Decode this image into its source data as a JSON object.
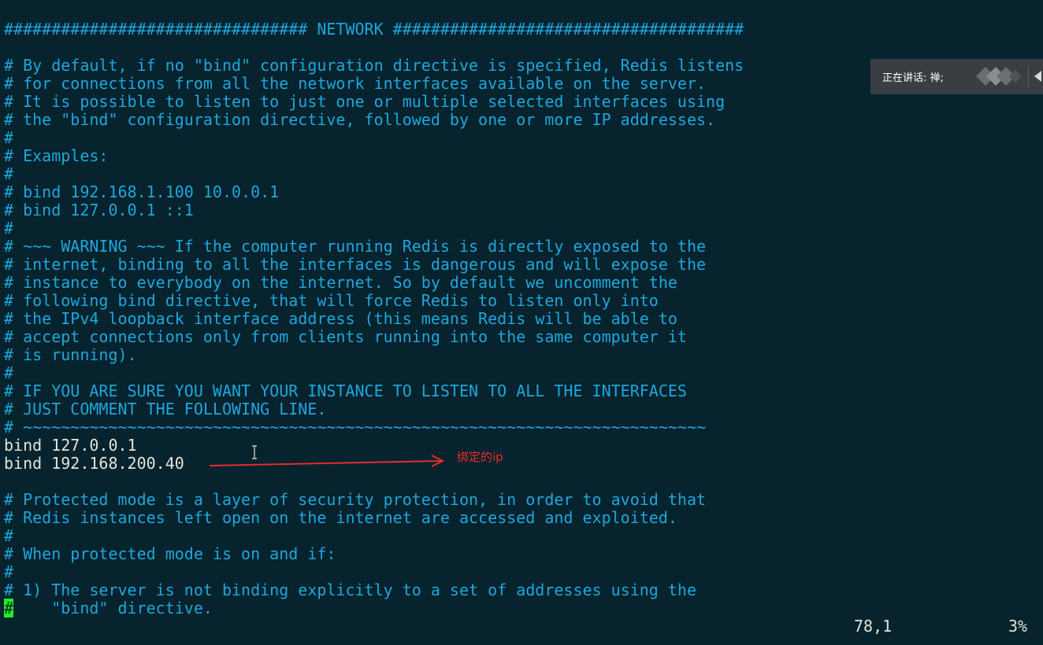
{
  "editor": {
    "lines": [
      "################################ NETWORK #####################################",
      "",
      "# By default, if no \"bind\" configuration directive is specified, Redis listens",
      "# for connections from all the network interfaces available on the server.",
      "# It is possible to listen to just one or multiple selected interfaces using",
      "# the \"bind\" configuration directive, followed by one or more IP addresses.",
      "#",
      "# Examples:",
      "#",
      "# bind 192.168.1.100 10.0.0.1",
      "# bind 127.0.0.1 ::1",
      "#",
      "# ~~~ WARNING ~~~ If the computer running Redis is directly exposed to the",
      "# internet, binding to all the interfaces is dangerous and will expose the",
      "# instance to everybody on the internet. So by default we uncomment the",
      "# following bind directive, that will force Redis to listen only into",
      "# the IPv4 loopback interface address (this means Redis will be able to",
      "# accept connections only from clients running into the same computer it",
      "# is running).",
      "#",
      "# IF YOU ARE SURE YOU WANT YOUR INSTANCE TO LISTEN TO ALL THE INTERFACES",
      "# JUST COMMENT THE FOLLOWING LINE.",
      "# ~~~~~~~~~~~~~~~~~~~~~~~~~~~~~~~~~~~~~~~~~~~~~~~~~~~~~~~~~~~~~~~~~~~~~~~~",
      "bind 127.0.0.1",
      "bind 192.168.200.40",
      "",
      "# Protected mode is a layer of security protection, in order to avoid that",
      "# Redis instances left open on the internet are accessed and exploited.",
      "#",
      "# When protected mode is on and if:",
      "#",
      "# 1) The server is not binding explicitly to a set of addresses using the",
      "#    \"bind\" directive."
    ],
    "cursor_char": "#",
    "last_line_rest": "    \"bind\" directive."
  },
  "annotation": {
    "label": "绑定的ip",
    "color": "#e52b2b"
  },
  "speaking_panel": {
    "text": "正在讲话: 禅;"
  },
  "status": {
    "position": "78,1",
    "percent": "3%"
  },
  "colors": {
    "background": "#06232e",
    "comment": "#1fa7dc",
    "code": "#e4e4d8",
    "cursor": "#22ee22"
  }
}
